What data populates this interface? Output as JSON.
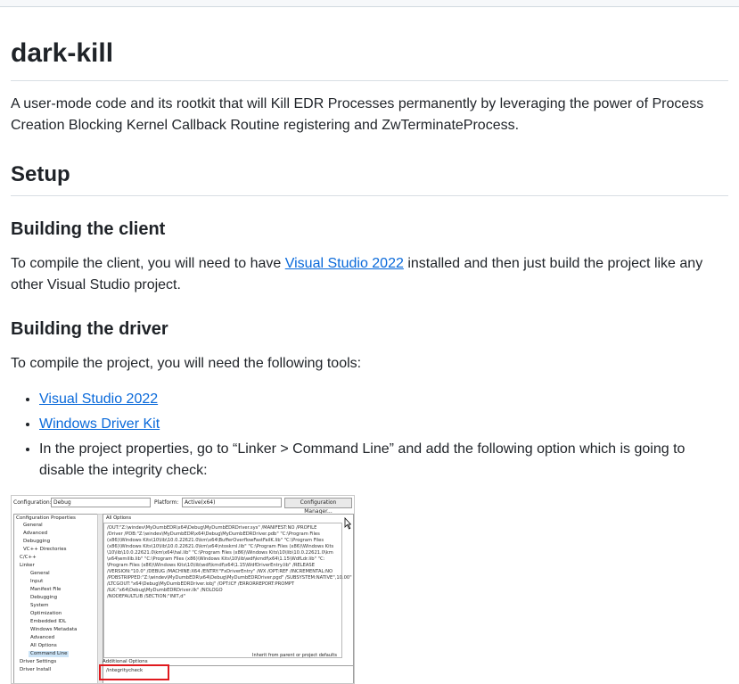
{
  "title": "dark-kill",
  "intro": "A user-mode code and its rootkit that will Kill EDR Processes permanently by leveraging the power of Process Creation Blocking Kernel Callback Routine registering and ZwTerminateProcess.",
  "setup": {
    "heading": "Setup",
    "client": {
      "heading": "Building the client",
      "text_before": "To compile the client, you will need to have ",
      "link": "Visual Studio 2022",
      "text_after": " installed and then just build the project like any other Visual Studio project."
    },
    "driver": {
      "heading": "Building the driver",
      "intro": "To compile the project, you will need the following tools:",
      "items": [
        {
          "label": "Visual Studio 2022"
        },
        {
          "label": "Windows Driver Kit"
        },
        {
          "label": "In the project properties, go to “Linker > Command Line” and add the following option which is going to disable the integrity check:"
        }
      ]
    }
  },
  "screenshot": {
    "configuration_label": "Configuration:",
    "configuration_value": "Debug",
    "platform_label": "Platform:",
    "platform_value": "Active(x64)",
    "config_manager": "Configuration Manager...",
    "tree": [
      "Configuration Properties",
      "General",
      "Advanced",
      "Debugging",
      "VC++ Directories",
      "C/C++",
      "Linker",
      "General",
      "Input",
      "Manifest File",
      "Debugging",
      "System",
      "Optimization",
      "Embedded IDL",
      "Windows Metadata",
      "Advanced",
      "All Options",
      "Command Line",
      "Driver Settings",
      "Driver Install"
    ],
    "all_options_label": "All Options",
    "command_lines": [
      "/OUT:\"Z:\\windev\\MyDumbEDR\\x64\\Debug\\MyDumbEDRDriver.sys\" /MANIFEST:NO /PROFILE",
      "/Driver /PDB:\"Z:\\windev\\MyDumbEDR\\x64\\Debug\\MyDumbEDRDriver.pdb\" \"C:\\Program Files",
      "(x86)\\Windows Kits\\10\\lib\\10.0.22621.0\\km\\x64\\BufferOverflowFastFailK.lib\" \"C:\\Program Files",
      "(x86)\\Windows Kits\\10\\lib\\10.0.22621.0\\km\\x64\\ntoskrnl.lib\" \"C:\\Program Files (x86)\\Windows Kits",
      "\\10\\lib\\10.0.22621.0\\km\\x64\\hal.lib\" \"C:\\Program Files (x86)\\Windows Kits\\10\\lib\\10.0.22621.0\\km",
      "\\x64\\wmilib.lib\" \"C:\\Program Files (x86)\\Windows Kits\\10\\lib\\wdf\\kmdf\\x64\\1.15\\WdfLdr.lib\" \"C:",
      "\\Program Files (x86)\\Windows Kits\\10\\lib\\wdf\\kmdf\\x64\\1.15\\WdfDriverEntry.lib\" /RELEASE",
      "/VERSION:\"10.0\" /DEBUG /MACHINE:X64 /ENTRY:\"FxDriverEntry\" /WX /OPT:REF /INCREMENTAL:NO",
      "/PDBSTRIPPED:\"Z:\\windev\\MyDumbEDR\\x64\\Debug\\MyDumbEDRDriver.pgd\" /SUBSYSTEM:NATIVE\",10.00\"",
      "/LTCGOUT:\"x64\\Debug\\MyDumbEDRDriver.iobj\" /OPT:ICF /ERRORREPORT:PROMPT",
      "/ILK:\"x64\\Debug\\MyDumbEDRDriver.ilk\" /NOLOGO",
      "/NODEFAULTLIB /SECTION:\"INIT,d\""
    ],
    "inherit_label": "Inherit from parent or project defaults",
    "additional_options_label": "Additional Options",
    "additional_options_value": "/integritycheck"
  }
}
